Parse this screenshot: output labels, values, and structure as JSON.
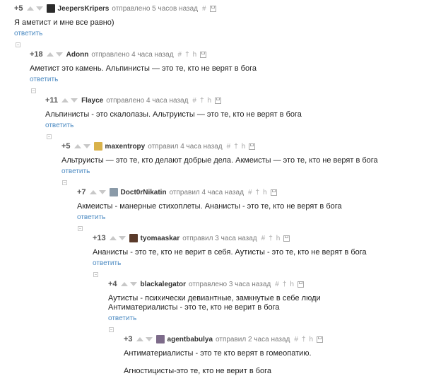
{
  "colors": {
    "link": "#4b8ac2",
    "vote_arrow": "#c8c8c8",
    "meta": "#7c7c7c"
  },
  "comments": [
    {
      "rating": "+5",
      "author": "JeepersKripers",
      "meta": "отправлено 5 часов назад",
      "text": "Я аметист и мне все равно)",
      "reply": "ответить"
    },
    {
      "rating": "+18",
      "author": "Adonn",
      "meta": "отправлено 4 часа назад",
      "text": "Аметист это камень. Альпинисты — это те, кто не верят в бога",
      "reply": "ответить"
    },
    {
      "rating": "+11",
      "author": "Flayce",
      "meta": "отправлено 4 часа назад",
      "text": "Альпинисты - это скалолазы. Альтруисты — это те, кто не верят в бога",
      "reply": "ответить"
    },
    {
      "rating": "+5",
      "author": "maxentropy",
      "meta": "отправил 4 часа назад",
      "text": "Альтруисты — это те, кто делают добрые дела. Акмеисты — это те, кто не верят в бога",
      "reply": "ответить"
    },
    {
      "rating": "+7",
      "author": "Doct0rNikatin",
      "meta": "отправил 4 часа назад",
      "text": "Акмеисты - манерные стихоплеты. Ананисты - это те, кто не верят в бога",
      "reply": "ответить"
    },
    {
      "rating": "+13",
      "author": "tyomaaskar",
      "meta": "отправил 3 часа назад",
      "text": "Ананисты - это те, кто не верит в себя. Аутисты - это те, кто не верят в бога",
      "reply": "ответить"
    },
    {
      "rating": "+4",
      "author": "blackalegator",
      "meta": "отправлено 3 часа назад",
      "text": "Аутисты - психически девиантные, замкнутые в себе люди",
      "text2": "Антиматериалисты - это те, кто не верит в бога",
      "reply": "ответить"
    },
    {
      "rating": "+3",
      "author": "agentbabulya",
      "meta": "отправил 2 часа назад",
      "text": "Антиматериалисты - это те кто верят в гомеопатию.",
      "text2": "Агностицисты-это те, кто не верит в бога"
    }
  ]
}
